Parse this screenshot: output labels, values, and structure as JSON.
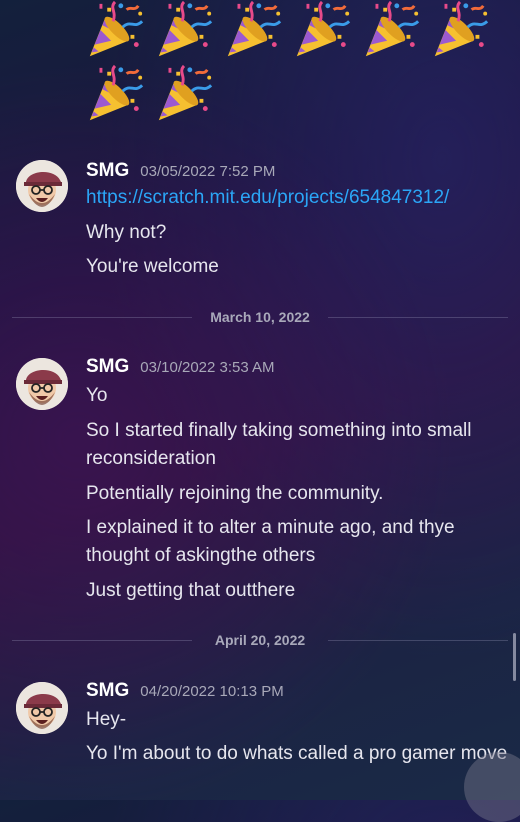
{
  "reaction_emoji": "party-popper-icon",
  "messages": [
    {
      "username": "SMG",
      "timestamp": "03/05/2022 7:52 PM",
      "lines": [
        "https://scratch.mit.edu/projects/654847312/",
        "Why not?",
        "You're welcome"
      ]
    },
    {
      "username": "SMG",
      "timestamp": "03/10/2022 3:53 AM",
      "lines": [
        "Yo",
        "So I started finally taking something into small reconsideration",
        "Potentially rejoining the community.",
        "I explained it to alter a minute ago, and thye thought of askingthe others",
        "Just getting that outthere"
      ]
    },
    {
      "username": "SMG",
      "timestamp": "04/20/2022 10:13 PM",
      "lines": [
        "Hey-",
        "Yo I'm about to do whats called a pro gamer move"
      ]
    }
  ],
  "dividers": {
    "first": "March 10, 2022",
    "second": "April 20, 2022"
  },
  "colors": {
    "link": "#2ba6f7",
    "username": "#ffffff",
    "timestamp": "#a8a8b8"
  }
}
